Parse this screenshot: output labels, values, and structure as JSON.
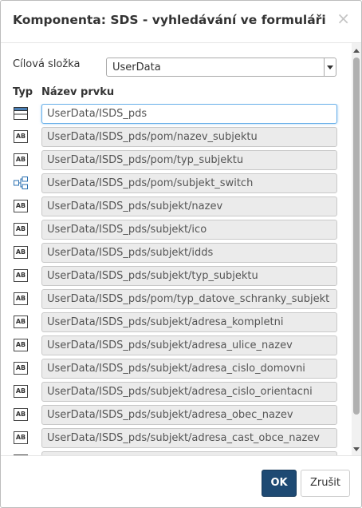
{
  "dialog": {
    "title": "Komponenta: SDS - vyhledávání ve formuláři",
    "close_symbol": "×"
  },
  "folder": {
    "label": "Cílová složka",
    "value": "UserData"
  },
  "columns": {
    "type": "Typ",
    "name": "Název prvku"
  },
  "rows": [
    {
      "icon": "form-icon",
      "value": "UserData/ISDS_pds"
    },
    {
      "icon": "text-field-icon",
      "value": "UserData/ISDS_pds/pom/nazev_subjektu",
      "icon_text": "AB"
    },
    {
      "icon": "text-field-icon",
      "value": "UserData/ISDS_pds/pom/typ_subjektu",
      "icon_text": "AB"
    },
    {
      "icon": "switch-icon",
      "value": "UserData/ISDS_pds/pom/subjekt_switch"
    },
    {
      "icon": "text-field-icon",
      "value": "UserData/ISDS_pds/subjekt/nazev",
      "icon_text": "AB"
    },
    {
      "icon": "text-field-icon",
      "value": "UserData/ISDS_pds/subjekt/ico",
      "icon_text": "AB"
    },
    {
      "icon": "text-field-icon",
      "value": "UserData/ISDS_pds/subjekt/idds",
      "icon_text": "AB"
    },
    {
      "icon": "text-field-icon",
      "value": "UserData/ISDS_pds/subjekt/typ_subjektu",
      "icon_text": "AB"
    },
    {
      "icon": "text-field-icon",
      "value": "UserData/ISDS_pds/pom/typ_datove_schranky_subjekt",
      "icon_text": "AB"
    },
    {
      "icon": "text-field-icon",
      "value": "UserData/ISDS_pds/subjekt/adresa_kompletni",
      "icon_text": "AB"
    },
    {
      "icon": "text-field-icon",
      "value": "UserData/ISDS_pds/subjekt/adresa_ulice_nazev",
      "icon_text": "AB"
    },
    {
      "icon": "text-field-icon",
      "value": "UserData/ISDS_pds/subjekt/adresa_cislo_domovni",
      "icon_text": "AB"
    },
    {
      "icon": "text-field-icon",
      "value": "UserData/ISDS_pds/subjekt/adresa_cislo_orientacni",
      "icon_text": "AB"
    },
    {
      "icon": "text-field-icon",
      "value": "UserData/ISDS_pds/subjekt/adresa_obec_nazev",
      "icon_text": "AB"
    },
    {
      "icon": "text-field-icon",
      "value": "UserData/ISDS_pds/subjekt/adresa_cast_obce_nazev",
      "icon_text": "AB"
    },
    {
      "icon": "text-field-icon",
      "value": "",
      "icon_text": "AB"
    }
  ],
  "buttons": {
    "ok": "OK",
    "cancel": "Zrušit"
  },
  "colors": {
    "primary_button": "#1e4a73",
    "focus_border": "#66afe9",
    "field_bg": "#ebebeb"
  }
}
